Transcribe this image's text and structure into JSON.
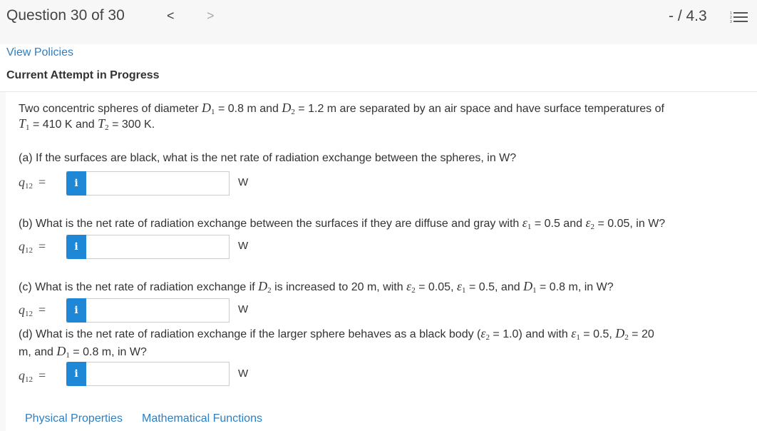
{
  "header": {
    "question_label": "Question 30 of 30",
    "prev_icon": "chevron-left-icon",
    "next_icon": "chevron-right-icon",
    "score": "- / 4.3",
    "list_icon": "numbered-list-icon"
  },
  "policies_link": "View Policies",
  "attempt_status": "Current Attempt in Progress",
  "problem": {
    "line1_a": "Two concentric spheres of diameter ",
    "D1": "D",
    "eq1": " = 0.8 m and ",
    "D2": "D",
    "eq2": " = 1.2 m are separated by an air space and have surface temperatures of",
    "T1": "T",
    "eq3": " = 410 K and ",
    "T2": "T",
    "eq4": " = 300 K.",
    "sub1": "1",
    "sub2": "2"
  },
  "parts": [
    {
      "question": "(a) If the surfaces are black, what is the net rate of radiation exchange between the spheres, in W?",
      "value": "",
      "unit": "W"
    },
    {
      "question_a": "(b) What is the net rate of radiation exchange between the surfaces if they are diffuse and gray with ",
      "question_b": " = 0.5 and ",
      "question_c": " = 0.05, in W?",
      "value": "",
      "unit": "W"
    },
    {
      "question_a": "(c) What is the net rate of radiation exchange if ",
      "question_b": " is increased to 20 m, with ",
      "question_c": " = 0.05, ",
      "question_d": " = 0.5, and ",
      "question_e": " = 0.8 m, in W?",
      "value": "",
      "unit": "W"
    },
    {
      "question_a": "(d) What is the net rate of radiation exchange if the larger sphere behaves as a black body (",
      "question_b": " = 1.0) and with ",
      "question_c": " = 0.5, ",
      "question_d": " = 20",
      "question_line2_a": "m, and ",
      "question_line2_b": " = 0.8 m, in W?",
      "value": "",
      "unit": "W"
    }
  ],
  "answer_label": "q",
  "answer_sub": "12",
  "answer_eq": "=",
  "info_glyph": "i",
  "eps": "ε",
  "footer_links": [
    "Physical Properties",
    "Mathematical Functions"
  ]
}
